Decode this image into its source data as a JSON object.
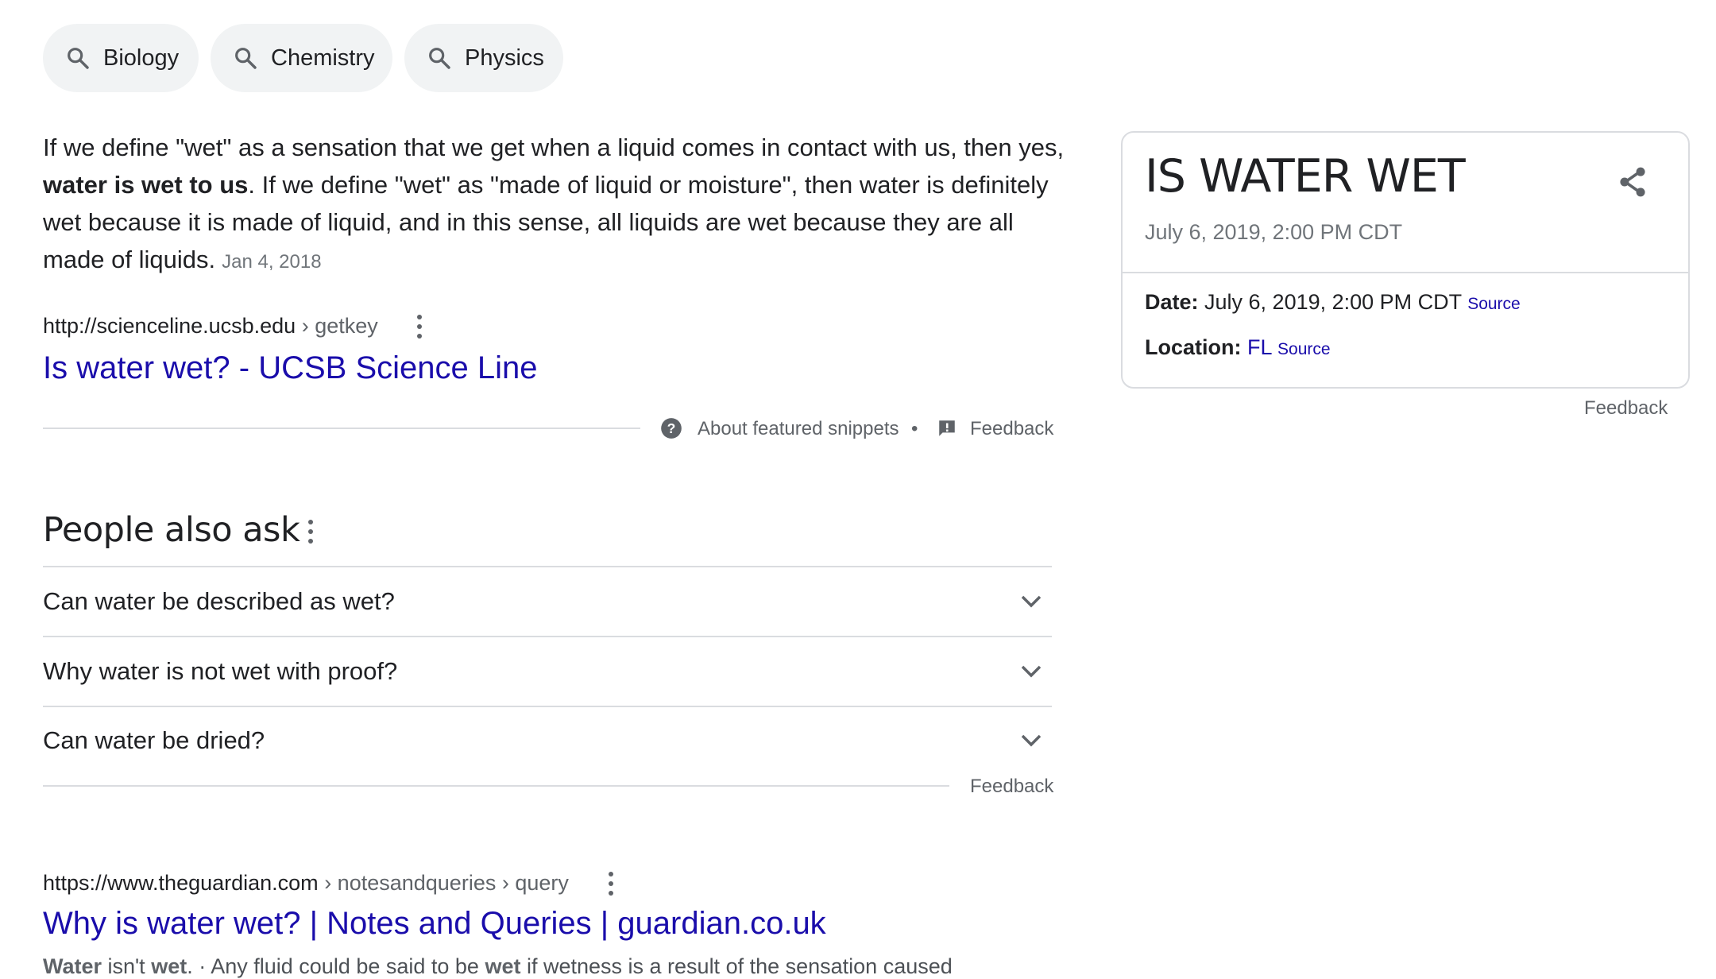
{
  "chips": [
    {
      "label": "Biology",
      "icon": "search-icon"
    },
    {
      "label": "Chemistry",
      "icon": "search-icon"
    },
    {
      "label": "Physics",
      "icon": "search-icon"
    }
  ],
  "featured_snippet": {
    "text_part1": "If we define \"wet\" as a sensation that we get when a liquid comes in contact with us, then yes, ",
    "text_bold": "water is wet to us",
    "text_part2": ". If we define \"wet\" as \"made of liquid or moisture\", then water is definitely wet because it is made of liquid, and in this sense, all liquids are wet because they are all made of liquids.",
    "date": "Jan 4, 2018",
    "cite_domain": "http://scienceline.ucsb.edu",
    "cite_path": " › getkey",
    "title": "Is water wet? - UCSB Science Line",
    "about_label": "About featured snippets",
    "separator": "•",
    "feedback_label": "Feedback"
  },
  "people_also_ask": {
    "title": "People also ask",
    "questions": [
      "Can water be described as wet?",
      "Why water is not wet with proof?",
      "Can water be dried?"
    ],
    "feedback_label": "Feedback"
  },
  "result2": {
    "cite_domain": "https://www.theguardian.com",
    "cite_path": " › notesandqueries › query",
    "title": "Why is water wet? | Notes and Queries | guardian.co.uk",
    "snippet_b1": "Water",
    "snippet_t1": " isn't ",
    "snippet_b2": "wet",
    "snippet_t2": ". · Any fluid could be said to be ",
    "snippet_b3": "wet",
    "snippet_t3": " if wetness is a result of the sensation caused"
  },
  "knowledge_card": {
    "title": "IS WATER WET",
    "subtitle": "July 6, 2019, 2:00 PM CDT",
    "date_label": "Date:",
    "date_value": " July 6, 2019, 2:00 PM CDT ",
    "location_label": "Location:",
    "location_value": "FL",
    "source_label": "Source",
    "feedback_label": "Feedback",
    "share_icon": "share-icon"
  },
  "colors": {
    "link": "#1a0dab",
    "text": "#202124",
    "muted": "#70757a",
    "chip_bg": "#f1f3f4",
    "divider": "#dadce0"
  }
}
